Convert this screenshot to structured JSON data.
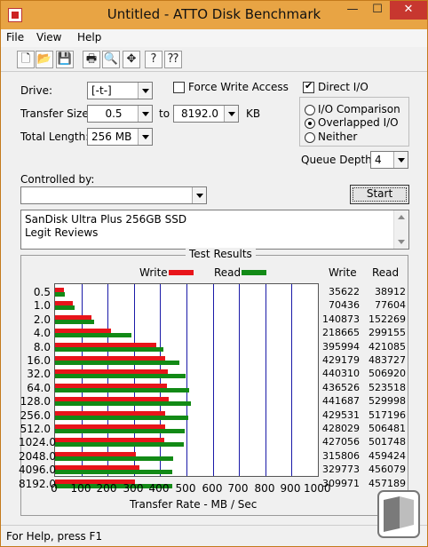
{
  "window": {
    "title": "Untitled - ATTO Disk Benchmark",
    "min_glyph": "—",
    "max_glyph": "☐",
    "close_glyph": "✕"
  },
  "menu": [
    "File",
    "View",
    "Help"
  ],
  "toolbar": [
    {
      "name": "new-document-icon",
      "glyph": "🗋"
    },
    {
      "name": "open-folder-icon",
      "glyph": "📂"
    },
    {
      "name": "save-icon",
      "glyph": "💾"
    },
    {
      "name": "print-icon",
      "glyph": "🖶"
    },
    {
      "name": "print-preview-icon",
      "glyph": "🔍"
    },
    {
      "name": "move-icon",
      "glyph": "✥"
    },
    {
      "name": "help-icon",
      "glyph": "?"
    },
    {
      "name": "context-help-icon",
      "glyph": "⁇"
    }
  ],
  "form": {
    "drive_label": "Drive:",
    "drive_value": "[-t-]",
    "transfer_size_label": "Transfer Size:",
    "transfer_from": "0.5",
    "transfer_to_label": "to",
    "transfer_to": "8192.0",
    "transfer_unit": "KB",
    "total_length_label": "Total Length:",
    "total_length_value": "256 MB",
    "force_write_label": "Force Write Access",
    "force_write_checked": false,
    "direct_io_label": "Direct I/O",
    "direct_io_checked": true,
    "io_comparison_label": "I/O Comparison",
    "overlapped_io_label": "Overlapped I/O",
    "neither_label": "Neither",
    "selected_mode": "overlapped",
    "queue_depth_label": "Queue Depth:",
    "queue_depth_value": "4",
    "controlled_by_label": "Controlled by:",
    "controlled_by_value": "",
    "start_label": "Start",
    "description_lines": [
      "SanDisk Ultra Plus 256GB SSD",
      "Legit Reviews"
    ]
  },
  "results": {
    "title": "Test Results",
    "write_legend": "Write",
    "read_legend": "Read",
    "write_col": "Write",
    "read_col": "Read",
    "write_color": "#e8141a",
    "read_color": "#128a16",
    "xlabel": "Transfer Rate - MB / Sec"
  },
  "chart_data": {
    "type": "bar",
    "orientation": "horizontal",
    "categories": [
      "0.5",
      "1.0",
      "2.0",
      "4.0",
      "8.0",
      "16.0",
      "32.0",
      "64.0",
      "128.0",
      "256.0",
      "512.0",
      "1024.0",
      "2048.0",
      "4096.0",
      "8192.0"
    ],
    "series": [
      {
        "name": "Write",
        "values": [
          35622,
          70436,
          140873,
          218665,
          395994,
          429179,
          440310,
          436526,
          441687,
          429531,
          428029,
          427056,
          315806,
          329773,
          309971
        ]
      },
      {
        "name": "Read",
        "values": [
          38912,
          77604,
          152269,
          299155,
          421085,
          483727,
          506920,
          523518,
          529998,
          517196,
          506481,
          501748,
          459424,
          456079,
          457189
        ]
      }
    ],
    "xlabel": "Transfer Rate - MB / Sec",
    "xticks": [
      "0",
      "100",
      "200",
      "300",
      "400",
      "500",
      "600",
      "700",
      "800",
      "900",
      "1000"
    ],
    "xlim": [
      0,
      1000
    ],
    "grid": true,
    "legend": "top"
  },
  "status": {
    "text": "For Help, press F1"
  }
}
